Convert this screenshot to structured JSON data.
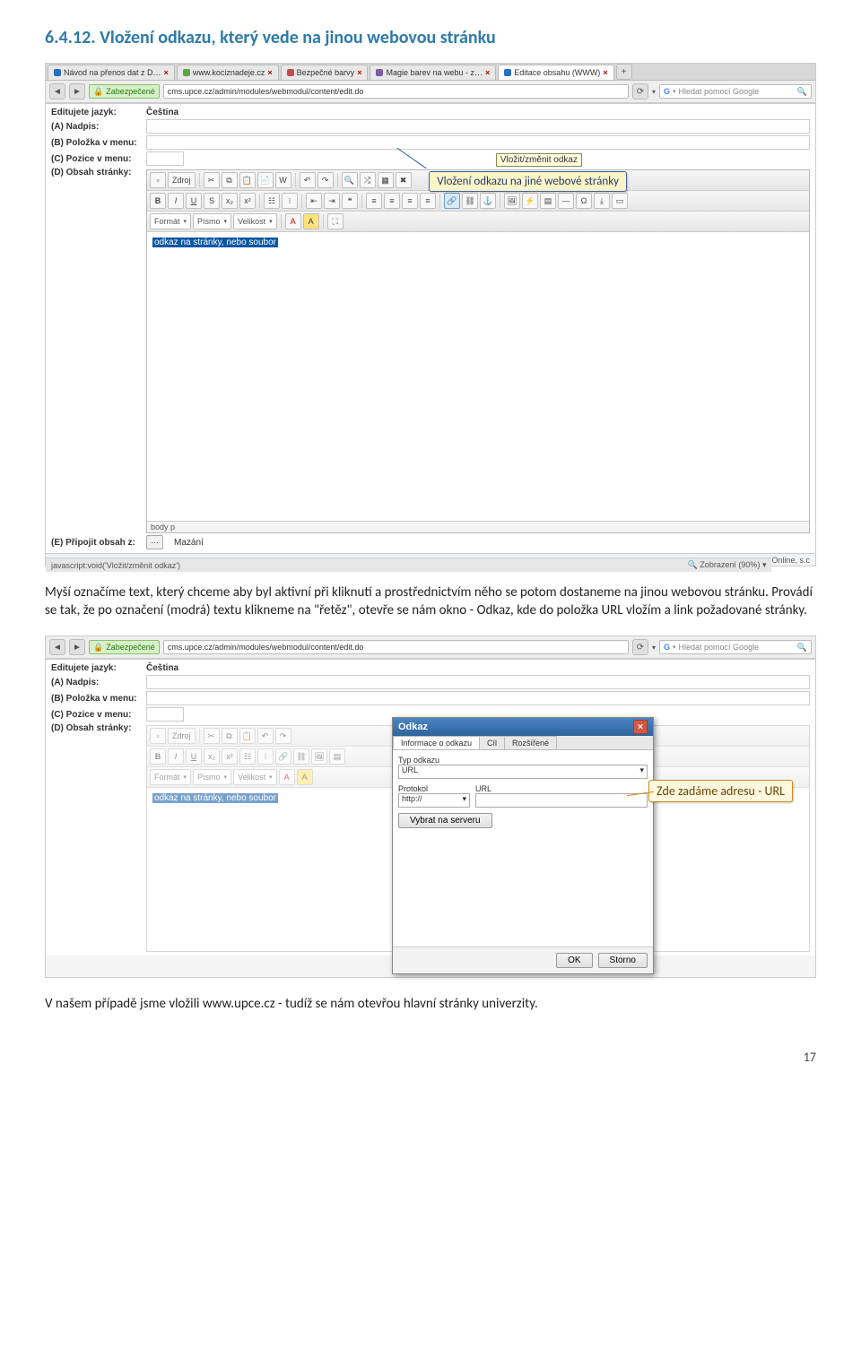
{
  "section_heading": "6.4.12. Vložení odkazu, který vede na jinou webovou stránku",
  "screenshot1": {
    "tabs": [
      {
        "label": "Návod na přenos dat z D…",
        "favicon": "#2a6ebf"
      },
      {
        "label": "www.kociznadeje.cz",
        "favicon": "#5aa745"
      },
      {
        "label": "Bezpečné barvy",
        "favicon": "#c0504d"
      },
      {
        "label": "Magie barev na webu - z…",
        "favicon": "#7f5aa7"
      },
      {
        "label": "Editace obsahu (WWW)",
        "favicon": "#2a6ebf"
      }
    ],
    "security_label": "Zabezpečené",
    "url": "cms.upce.cz/admin/modules/webmodul/content/edit.do",
    "search_placeholder": "Hledat pomocí Google",
    "form": {
      "lang_label": "Editujete jazyk:",
      "lang_value": "Čeština",
      "a_label": "(A) Nadpis:",
      "b_label": "(B) Položka v menu:",
      "c_label": "(C) Pozice v menu:",
      "d_label": "(D) Obsah stránky:",
      "e_label": "(E) Připojit obsah z:",
      "mazani_label": "Mazání",
      "online_label": "Online, s.c"
    },
    "toolbar": {
      "zdroj_label": "Zdroj",
      "format_label": "Formát",
      "pismo_label": "Písmo",
      "velikost_label": "Velikost",
      "link_tooltip": "Vložit/změnit odkaz"
    },
    "selected_text": "odkaz na stránky, nebo soubor",
    "status_path": "body p",
    "statusbar_left": "javascript:void('Vložit/změnit odkaz')",
    "statusbar_right": "Zobrazení (90%)",
    "callout_text": "Vložení odkazu na jiné webové stránky"
  },
  "paragraph1": "Myší označíme text, který chceme aby byl aktivní při kliknutí a prostřednictvím něho se potom dostaneme na jinou webovou stránku. Provádí se tak, že po označení (modrá) textu klikneme na \"řetěz\", otevře se nám okno - Odkaz, kde do položka URL vložím a link požadované stránky.",
  "screenshot2": {
    "security_label": "Zabezpečené",
    "url": "cms.upce.cz/admin/modules/webmodul/content/edit.do",
    "search_placeholder": "Hledat pomocí Google",
    "form": {
      "lang_label": "Editujete jazyk:",
      "lang_value": "Čeština",
      "a_label": "(A) Nadpis:",
      "b_label": "(B) Položka v menu:",
      "c_label": "(C) Pozice v menu:",
      "d_label": "(D) Obsah stránky:"
    },
    "toolbar": {
      "zdroj_label": "Zdroj",
      "format_label": "Formát",
      "pismo_label": "Písmo",
      "velikost_label": "Velikost"
    },
    "selected_text": "odkaz na stránky, nebo soubor",
    "dialog": {
      "title": "Odkaz",
      "tab_info": "Informace o odkazu",
      "tab_target": "Cíl",
      "tab_advanced": "Rozšířené",
      "type_label": "Typ odkazu",
      "type_value": "URL",
      "protocol_label": "Protokol",
      "protocol_value": "http://",
      "url_label": "URL",
      "browse_server_label": "Vybrat na serveru",
      "ok_label": "OK",
      "cancel_label": "Storno"
    },
    "callout_text": "Zde zadáme adresu -  URL"
  },
  "paragraph2": "V našem případě jsme vložili www.upce.cz - tudíž se nám otevřou hlavní stránky univerzity.",
  "page_number": "17"
}
